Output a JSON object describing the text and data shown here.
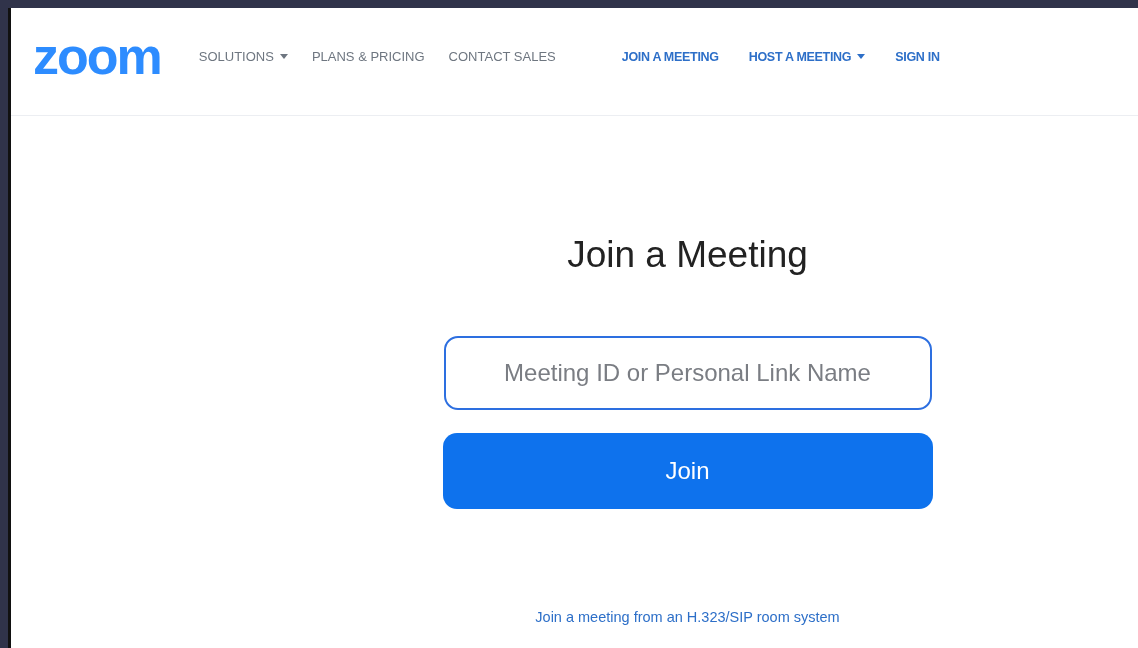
{
  "header": {
    "logo": "zoom",
    "nav": [
      {
        "label": "SOLUTIONS",
        "kind": "plain",
        "dropdown": true
      },
      {
        "label": "PLANS & PRICING",
        "kind": "plain",
        "dropdown": false
      },
      {
        "label": "CONTACT SALES",
        "kind": "plain",
        "dropdown": false
      },
      {
        "label": "JOIN A MEETING",
        "kind": "accent",
        "dropdown": false
      },
      {
        "label": "HOST A MEETING",
        "kind": "accent",
        "dropdown": true
      },
      {
        "label": "SIGN IN",
        "kind": "accent",
        "dropdown": false
      }
    ]
  },
  "title": "Join a Meeting",
  "meeting_field": {
    "placeholder": "Meeting ID or Personal Link Name"
  },
  "join_button": "Join",
  "room_system_link": "Join a meeting from an H.323/SIP room system"
}
